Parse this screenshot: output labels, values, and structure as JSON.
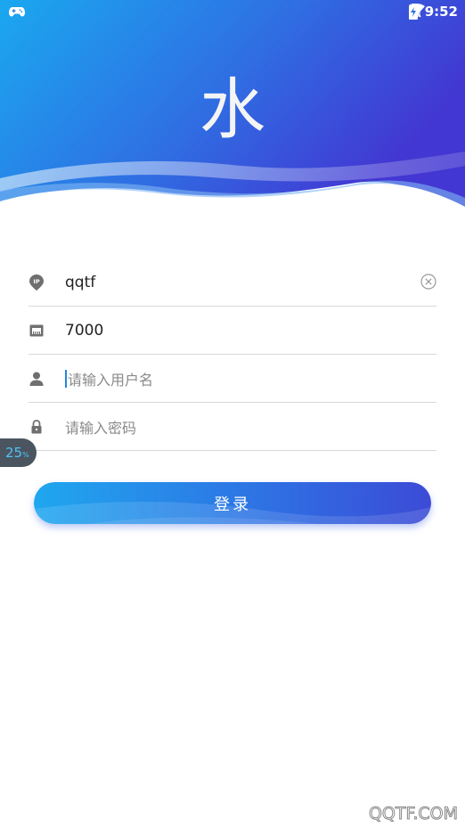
{
  "status_bar": {
    "time": "9:52",
    "icons": [
      "gamepad-icon",
      "wifi-icon",
      "no-sim-icon",
      "battery-charging-icon"
    ]
  },
  "header": {
    "logo_text": "水"
  },
  "form": {
    "server": {
      "value": "qqtf",
      "icon": "ip-location-icon"
    },
    "port": {
      "value": "7000",
      "icon": "port-icon"
    },
    "username": {
      "placeholder": "请输入用户名",
      "icon": "user-icon"
    },
    "password": {
      "placeholder": "请输入密码",
      "icon": "lock-icon"
    }
  },
  "login_button": {
    "label": "登录"
  },
  "floating_badge": {
    "value": "25",
    "unit": "%"
  },
  "watermark": "QQTF.COM",
  "colors": {
    "gradient_start": "#1aa6ee",
    "gradient_end": "#3e44d6",
    "icon_gray": "#6f6f6f"
  }
}
